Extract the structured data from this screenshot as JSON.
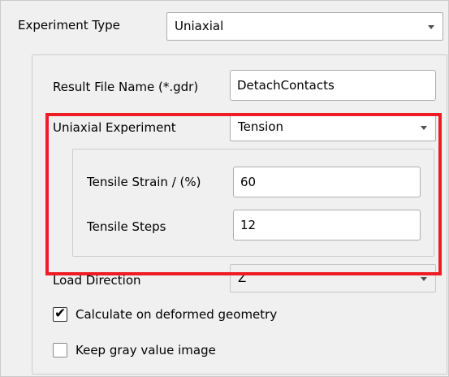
{
  "experiment_type": {
    "label": "Experiment Type",
    "value": "Uniaxial"
  },
  "result_file": {
    "label": "Result File Name (*.gdr)",
    "value": "DetachContacts"
  },
  "uniaxial_experiment": {
    "label": "Uniaxial Experiment",
    "value": "Tension"
  },
  "tensile_strain": {
    "label": "Tensile Strain / (%)",
    "value": "60"
  },
  "tensile_steps": {
    "label": "Tensile Steps",
    "value": "12"
  },
  "load_direction": {
    "label": "Load Direction",
    "value": "Z"
  },
  "calculate_deformed": {
    "label": "Calculate on deformed geometry",
    "checked": true
  },
  "keep_gray": {
    "label": "Keep gray value image",
    "checked": false
  },
  "colors": {
    "highlight": "#ee1c24",
    "panel": "#f0f0f0"
  },
  "icons": {
    "dropdown": "chevron-down-icon",
    "check": "checkmark-icon"
  }
}
